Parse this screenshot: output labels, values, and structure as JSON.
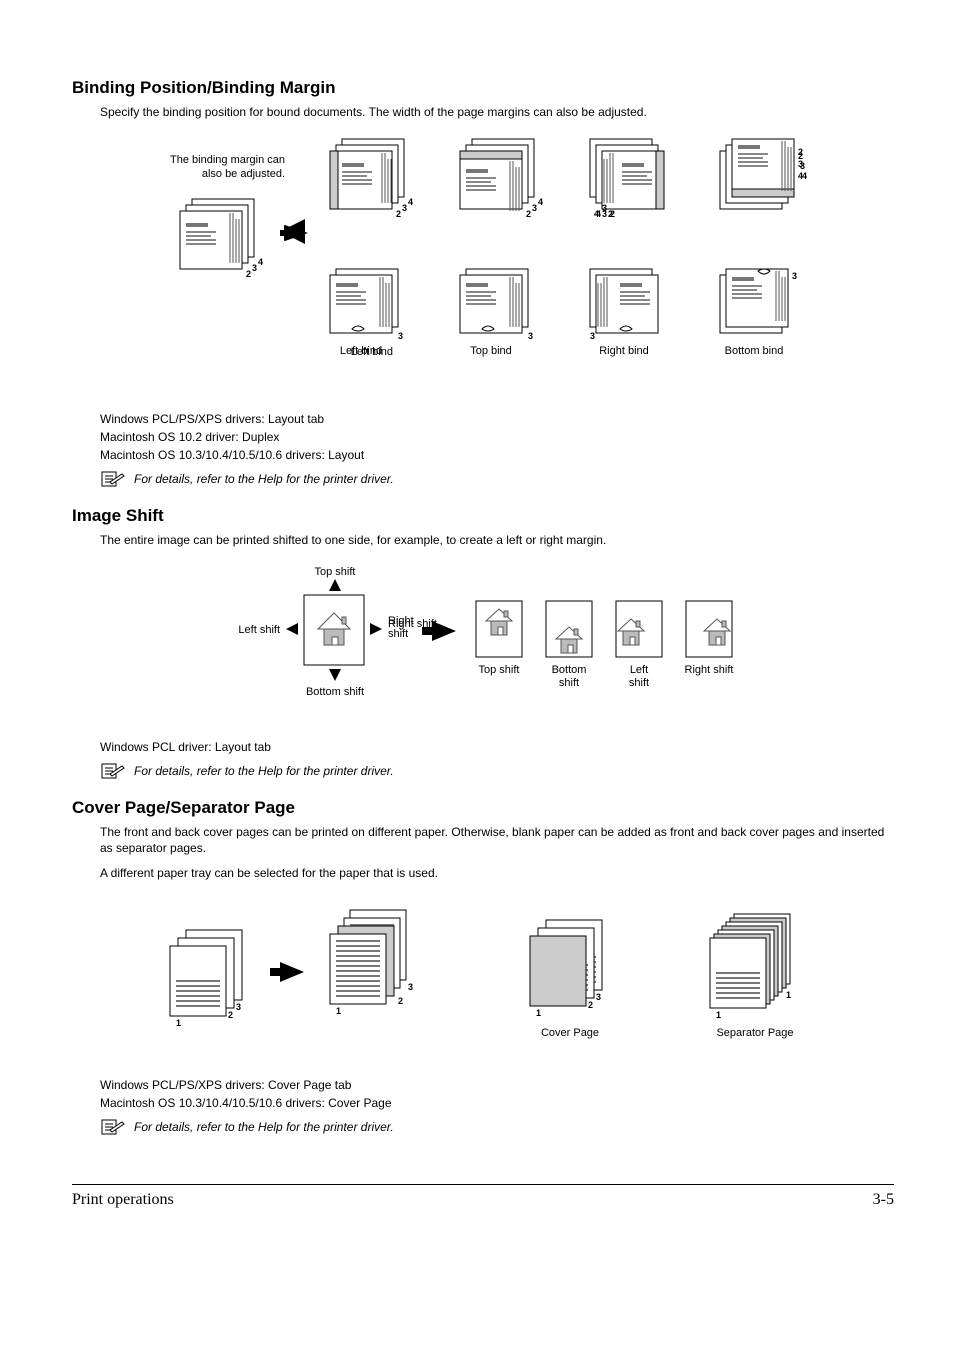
{
  "sections": {
    "binding": {
      "heading": "Binding Position/Binding Margin",
      "intro": "Specify the binding position for bound documents. The width of the page margins can also be adjusted.",
      "diagram": {
        "adjust_label1": "The binding margin can",
        "adjust_label2": "also be adjusted.",
        "left_bind": "Left bind",
        "top_bind": "Top bind",
        "right_bind": "Right bind",
        "bottom_bind": "Bottom bind"
      },
      "drivers": {
        "win": "Windows PCL/PS/XPS drivers: Layout tab",
        "mac102": "Macintosh OS 10.2 driver: Duplex",
        "mac103": "Macintosh OS 10.3/10.4/10.5/10.6 drivers: Layout"
      },
      "note": "For details, refer to the Help for the printer driver."
    },
    "imageshift": {
      "heading": "Image Shift",
      "intro": "The entire image can be printed shifted to one side, for example, to create a left or right margin.",
      "diagram": {
        "top_shift": "Top shift",
        "bottom_shift": "Bottom shift",
        "left_shift": "Left shift",
        "right_shift": "Right shift",
        "res_top": "Top shift",
        "res_bottom1": "Bottom",
        "res_bottom2": "shift",
        "res_left1": "Left",
        "res_left2": "shift",
        "res_right": "Right shift"
      },
      "drivers": {
        "win": "Windows PCL driver: Layout tab"
      },
      "note": "For details, refer to the Help for the printer driver."
    },
    "cover": {
      "heading": "Cover Page/Separator Page",
      "intro1": "The front and back cover pages can be printed on different paper. Otherwise, blank paper can be added as front and back cover pages and inserted as separator pages.",
      "intro2": "A different paper tray can be selected for the paper that is used.",
      "diagram": {
        "cover_label": "Cover Page",
        "separator_label": "Separator Page"
      },
      "drivers": {
        "win": "Windows PCL/PS/XPS drivers: Cover Page tab",
        "mac103": "Macintosh OS 10.3/10.4/10.5/10.6 drivers: Cover Page"
      },
      "note": "For details, refer to the Help for the printer driver."
    }
  },
  "footer": {
    "left": "Print operations",
    "right": "3-5"
  }
}
